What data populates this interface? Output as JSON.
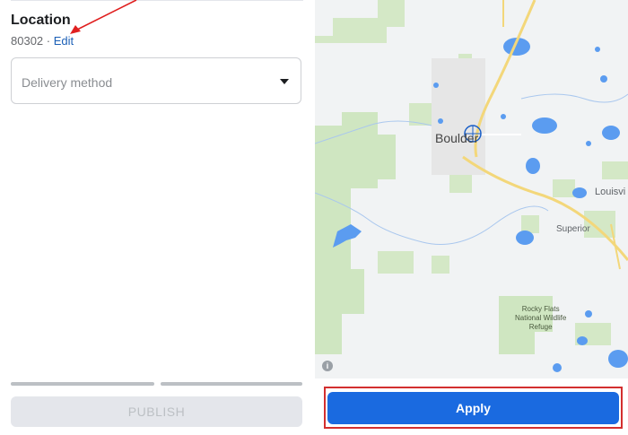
{
  "location": {
    "title": "Location",
    "zip": "80302",
    "separator": " · ",
    "edit_label": "Edit"
  },
  "delivery": {
    "placeholder": "Delivery method"
  },
  "publish": {
    "label": "PUBLISH"
  },
  "map": {
    "labels": {
      "boulder": "Boulder",
      "louisville": "Louisvi",
      "superior": "Superior",
      "rocky_flats": "Rocky Flats\nNational Wildlife\nRefuge"
    },
    "info": "i"
  },
  "apply": {
    "label": "Apply"
  },
  "colors": {
    "accent": "#1a6ae0",
    "link": "#1b5fb6",
    "highlight": "#d32f2f",
    "park": "#cfe6c1",
    "water": "#5b9cf0",
    "road": "#f3d77a"
  }
}
